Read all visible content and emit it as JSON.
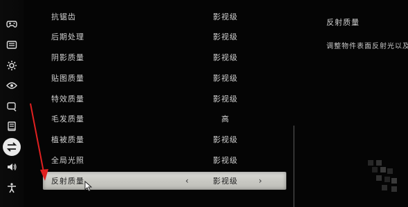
{
  "sidebar": {
    "items": [
      {
        "icon": "gamepad-icon",
        "glyph": "◉"
      },
      {
        "icon": "keyboard-icon",
        "glyph": "▦"
      },
      {
        "icon": "gear-icon",
        "glyph": "✲"
      },
      {
        "icon": "eye-icon",
        "glyph": "◎"
      },
      {
        "icon": "chat-icon",
        "glyph": "▢"
      },
      {
        "icon": "book-icon",
        "glyph": "▤"
      },
      {
        "icon": "swap-icon",
        "glyph": "⇄"
      },
      {
        "icon": "speaker-icon",
        "glyph": "◀"
      },
      {
        "icon": "accessibility-icon",
        "glyph": "✱"
      }
    ]
  },
  "settings": {
    "rows": [
      {
        "label": "抗锯齿",
        "value": "影视级"
      },
      {
        "label": "后期处理",
        "value": "影视级"
      },
      {
        "label": "阴影质量",
        "value": "影视级"
      },
      {
        "label": "贴图质量",
        "value": "影视级"
      },
      {
        "label": "特效质量",
        "value": "影视级"
      },
      {
        "label": "毛发质量",
        "value": "高"
      },
      {
        "label": "植被质量",
        "value": "影视级"
      },
      {
        "label": "全局光照",
        "value": "影视级"
      },
      {
        "label": "反射质量",
        "value": "影视级"
      }
    ],
    "prev_arrow": "‹",
    "next_arrow": "›"
  },
  "detail": {
    "title": "反射质量",
    "description": "调整物件表面反射光以及"
  },
  "colors": {
    "background": "#050505",
    "selected_row": "#cfcfca",
    "annotation_red": "#e02020"
  }
}
